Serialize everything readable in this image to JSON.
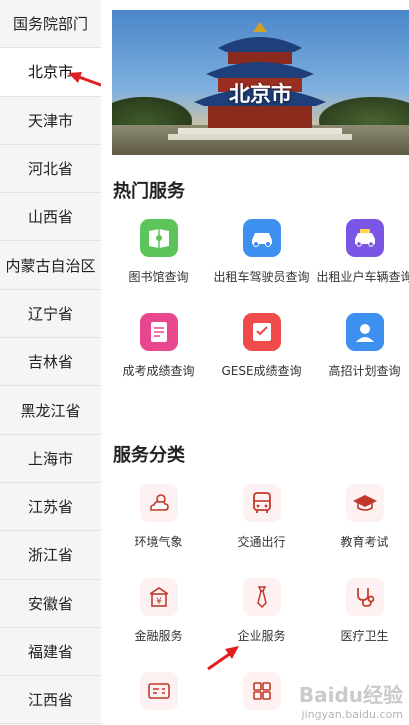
{
  "sidebar": {
    "items": [
      {
        "label": "国务院部门"
      },
      {
        "label": "北京市"
      },
      {
        "label": "天津市"
      },
      {
        "label": "河北省"
      },
      {
        "label": "山西省"
      },
      {
        "label": "内蒙古自治区"
      },
      {
        "label": "辽宁省"
      },
      {
        "label": "吉林省"
      },
      {
        "label": "黑龙江省"
      },
      {
        "label": "上海市"
      },
      {
        "label": "江苏省"
      },
      {
        "label": "浙江省"
      },
      {
        "label": "安徽省"
      },
      {
        "label": "福建省"
      },
      {
        "label": "江西省"
      }
    ],
    "active": "北京市"
  },
  "banner": {
    "title": "北京市"
  },
  "hot_services": {
    "title": "热门服务",
    "items": [
      {
        "label": "图书馆查询",
        "icon": "book-icon",
        "color": "#5cc45a"
      },
      {
        "label": "出租车驾驶员查询",
        "icon": "taxi-driver-icon",
        "color": "#3d8ff0"
      },
      {
        "label": "出租业户车辆查询",
        "icon": "taxi-icon",
        "color": "#7b56e6"
      },
      {
        "label": "成考成绩查询",
        "icon": "exam-score-icon",
        "color": "#e8478f"
      },
      {
        "label": "GESE成绩查询",
        "icon": "gese-certificate-icon",
        "color": "#ef4b4b"
      },
      {
        "label": "高招计划查询",
        "icon": "admission-plan-icon",
        "color": "#3d8ff0"
      }
    ]
  },
  "categories": {
    "title": "服务分类",
    "items": [
      {
        "label": "环境气象",
        "icon": "weather-icon"
      },
      {
        "label": "交通出行",
        "icon": "bus-icon"
      },
      {
        "label": "教育考试",
        "icon": "graduation-cap-icon"
      },
      {
        "label": "金融服务",
        "icon": "finance-icon"
      },
      {
        "label": "企业服务",
        "icon": "tie-icon"
      },
      {
        "label": "医疗卫生",
        "icon": "stethoscope-icon"
      },
      {
        "label": "",
        "icon": "id-card-icon"
      },
      {
        "label": "",
        "icon": "grid-apps-icon"
      }
    ],
    "icon_color": "#c0392b"
  },
  "watermark": {
    "text": "Baidu经验",
    "sub": "jingyan.baidu.com"
  }
}
